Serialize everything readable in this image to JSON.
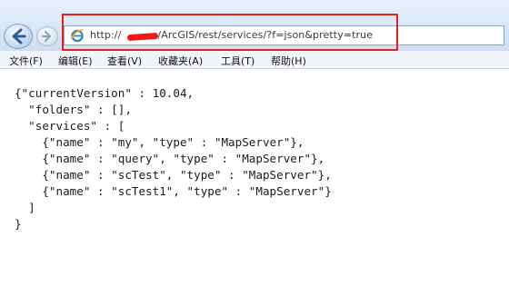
{
  "browser": {
    "address": {
      "url_prefix": "http://",
      "url_suffix": "/ArcGIS/rest/services/?f=json&pretty=true"
    },
    "icons": {
      "back": "arrow-left-icon",
      "forward": "arrow-right-icon",
      "page": "ie-page-icon"
    },
    "annotation_color": "#e0211d"
  },
  "menu": [
    {
      "label": "文件(F)"
    },
    {
      "label": "编辑(E)"
    },
    {
      "label": "查看(V)"
    },
    {
      "label": "收藏夹(A)"
    },
    {
      "label": "工具(T)"
    },
    {
      "label": "帮助(H)"
    }
  ],
  "json_lines": [
    "{\"currentVersion\" : 10.04,",
    "  \"folders\" : [],",
    "  \"services\" : [",
    "    {\"name\" : \"my\", \"type\" : \"MapServer\"},",
    "    {\"name\" : \"query\", \"type\" : \"MapServer\"},",
    "    {\"name\" : \"scTest\", \"type\" : \"MapServer\"},",
    "    {\"name\" : \"scTest1\", \"type\" : \"MapServer\"}",
    "  ]",
    "}"
  ]
}
